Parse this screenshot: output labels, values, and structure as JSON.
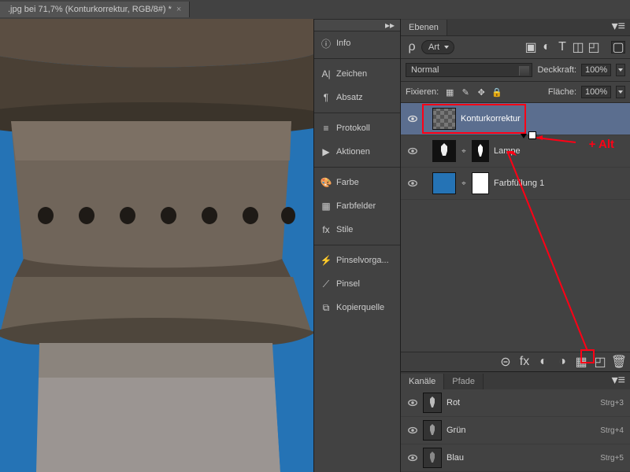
{
  "tab": {
    "title": ".jpg bei 71,7% (Konturkorrektur, RGB/8#) *",
    "close": "×"
  },
  "sidebar": {
    "items": [
      {
        "icon": "ⓘ",
        "label": "Info"
      },
      {
        "icon": "A|",
        "label": "Zeichen"
      },
      {
        "icon": "¶",
        "label": "Absatz"
      },
      {
        "icon": "≡",
        "label": "Protokoll"
      },
      {
        "icon": "▶",
        "label": "Aktionen"
      },
      {
        "icon": "🎨",
        "label": "Farbe"
      },
      {
        "icon": "▦",
        "label": "Farbfelder"
      },
      {
        "icon": "fx",
        "label": "Stile"
      },
      {
        "icon": "⚡",
        "label": "Pinselvorga..."
      },
      {
        "icon": "⟋",
        "label": "Pinsel"
      },
      {
        "icon": "⧉",
        "label": "Kopierquelle"
      }
    ],
    "expand": "▸▸"
  },
  "layersPanel": {
    "tab": "Ebenen",
    "filterLabel": "Art",
    "search": "ρ",
    "iconRow": [
      "▣",
      "◐",
      "T",
      "◫",
      "◰"
    ],
    "toggle": "▢",
    "blendMode": "Normal",
    "opacityLabel": "Deckkraft:",
    "opacityVal": "100%",
    "lockLabel": "Fixieren:",
    "lockIcons": [
      "▦",
      "✎",
      "✥",
      "🔒"
    ],
    "fillLabel": "Fläche:",
    "fillVal": "100%",
    "layers": [
      {
        "name": "Konturkorrektur"
      },
      {
        "name": "Lampe"
      },
      {
        "name": "Farbfüllung 1"
      }
    ],
    "footerIcons": [
      "⊝",
      "fx",
      "◐",
      "◑",
      "▦",
      "◰",
      "🗑"
    ]
  },
  "channels": {
    "tab1": "Kanäle",
    "tab2": "Pfade",
    "items": [
      {
        "name": "Rot",
        "shortcut": "Strg+3"
      },
      {
        "name": "Grün",
        "shortcut": "Strg+4"
      },
      {
        "name": "Blau",
        "shortcut": "Strg+5"
      }
    ]
  },
  "annotation": {
    "altLabel": "+ Alt"
  }
}
